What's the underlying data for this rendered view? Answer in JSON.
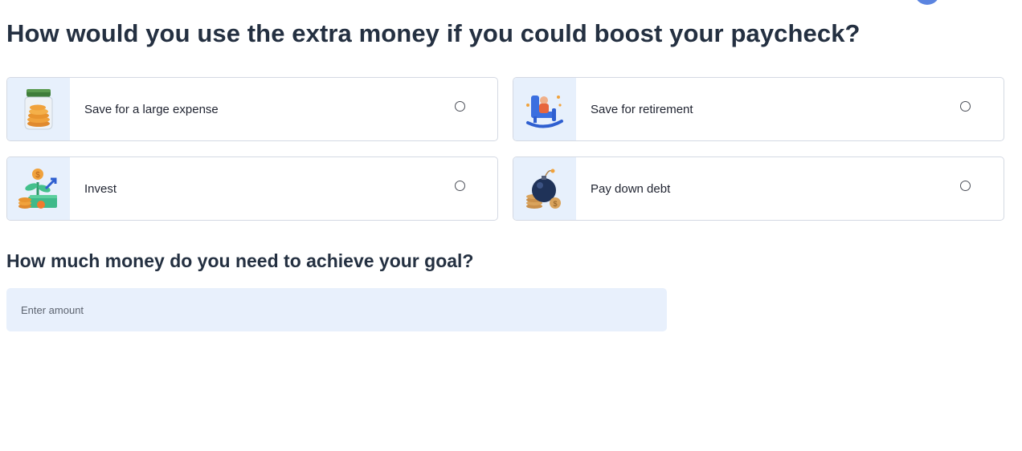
{
  "page": {
    "title": "How would you use the extra money if you could boost your paycheck?",
    "subtitle": "How much money do you need to achieve your goal?"
  },
  "options": [
    {
      "label": "Save for a large expense",
      "icon": "coin-jar-icon"
    },
    {
      "label": "Save for retirement",
      "icon": "rocking-chair-icon"
    },
    {
      "label": "Invest",
      "icon": "money-plant-icon"
    },
    {
      "label": "Pay down debt",
      "icon": "debt-bomb-icon"
    }
  ],
  "amount": {
    "placeholder": "Enter amount",
    "value": ""
  },
  "colors": {
    "title": "#243041",
    "image_bg": "#e7f0fc",
    "input_bg": "#e8f0fc",
    "card_border": "#d4d9e3",
    "avatar": "#5b84e0"
  }
}
